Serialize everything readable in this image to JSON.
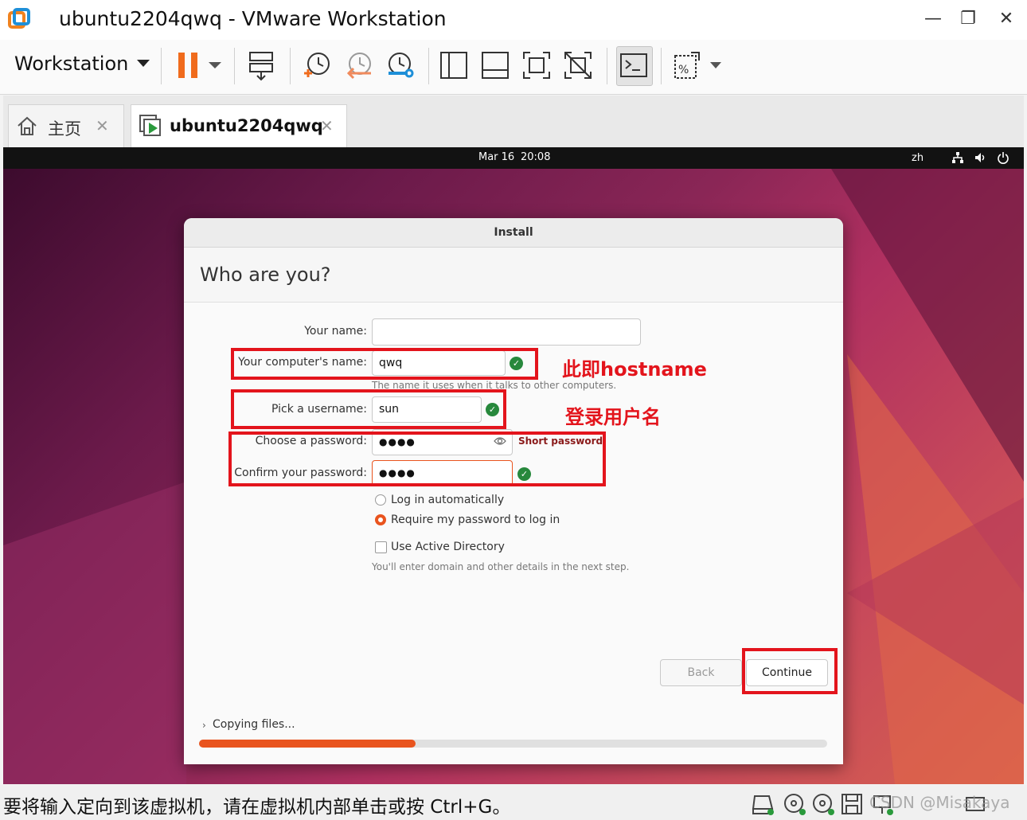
{
  "window": {
    "title": "ubuntu2204qwq - VMware Workstation",
    "controls": {
      "minimize": "—",
      "restore": "❐",
      "close": "✕"
    }
  },
  "toolbar": {
    "workstation_menu": "Workstation"
  },
  "tabs": [
    {
      "label": "主页",
      "close": "✕"
    },
    {
      "label": "ubuntu2204qwq",
      "close": "✕"
    }
  ],
  "guest_topbar": {
    "date": "Mar 16",
    "time": "20:08",
    "language": "zh"
  },
  "installer": {
    "dialog_title": "Install",
    "heading": "Who are you?",
    "fields": {
      "your_name": {
        "label": "Your name:",
        "value": ""
      },
      "computer_name": {
        "label": "Your computer's name:",
        "value": "qwq",
        "hint": "The name it uses when it talks to other computers."
      },
      "username": {
        "label": "Pick a username:",
        "value": "sun"
      },
      "password": {
        "label": "Choose a password:",
        "value": "●●●●",
        "strength": "Short password"
      },
      "confirm_password": {
        "label": "Confirm your password:",
        "value": "●●●●"
      }
    },
    "options": {
      "log_in_automatically": "Log in automatically",
      "require_password": "Require my password to log in",
      "use_active_directory": "Use Active Directory",
      "ad_hint": "You'll enter domain and other details in the next step."
    },
    "buttons": {
      "back": "Back",
      "continue": "Continue"
    },
    "progress": {
      "label": "Copying files...",
      "fraction": 0.345
    }
  },
  "annotations": {
    "hostname_note": "此即hostname",
    "username_note": "登录用户名"
  },
  "statusbar": {
    "message": "要将输入定向到该虚拟机，请在虚拟机内部单击或按 Ctrl+G。",
    "watermark": "CSDN @Misakaya"
  },
  "colors": {
    "accent": "#e9541e",
    "annotation_red": "#e3141c",
    "valid_green": "#27883c",
    "pause_orange": "#f06b1c"
  }
}
